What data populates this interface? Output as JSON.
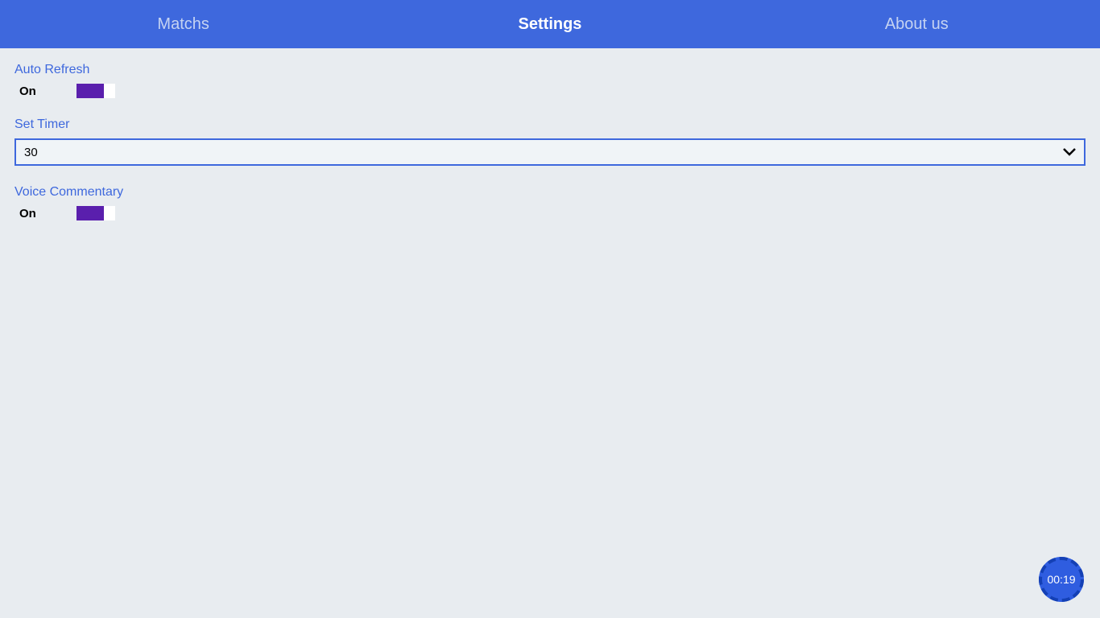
{
  "tabs": {
    "matchs": "Matchs",
    "settings": "Settings",
    "about": "About us"
  },
  "settings": {
    "auto_refresh": {
      "label": "Auto Refresh",
      "state": "On"
    },
    "set_timer": {
      "label": "Set Timer",
      "value": "30"
    },
    "voice_commentary": {
      "label": "Voice Commentary",
      "state": "On"
    }
  },
  "timer": "00:19"
}
